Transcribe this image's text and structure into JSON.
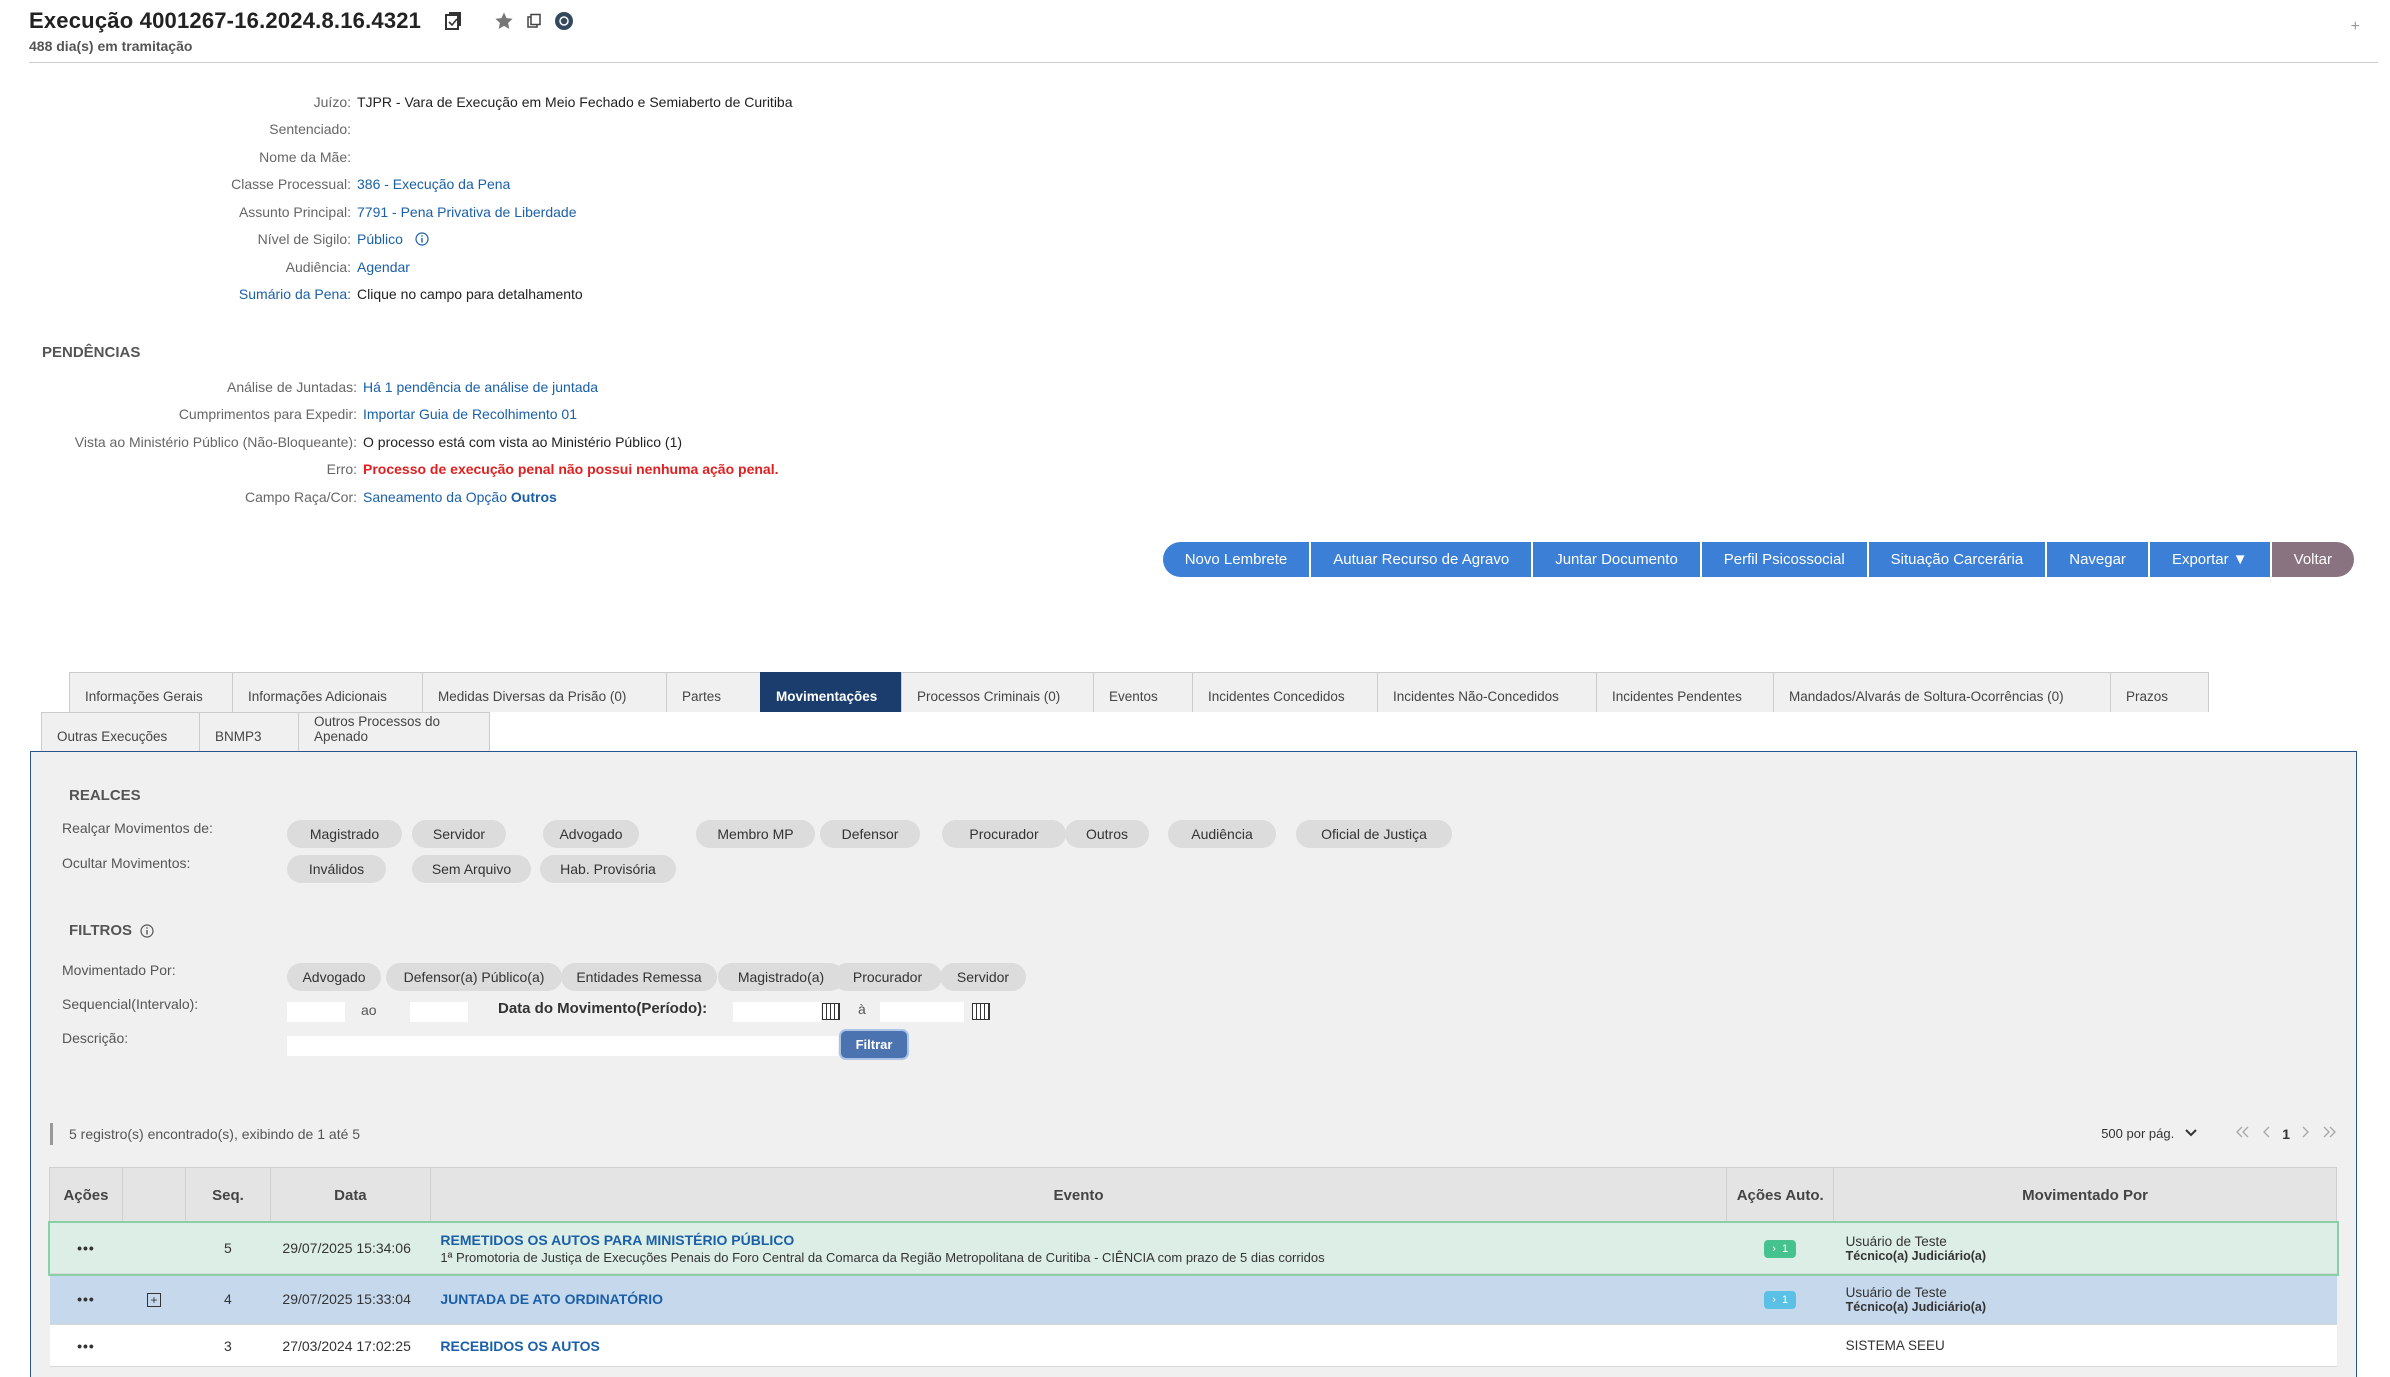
{
  "header": {
    "title": "Execução 4001267-16.2024.8.16.4321",
    "subtitle": "488 dia(s) em tramitação",
    "plus": "+"
  },
  "info": [
    {
      "label": "Juízo:",
      "value": "TJPR - Vara de Execução em Meio Fechado e Semiaberto de Curitiba"
    },
    {
      "label": "Sentenciado:",
      "value": ""
    },
    {
      "label": "Nome da Mãe:",
      "value": ""
    },
    {
      "label": "Classe Processual:",
      "value": "386 - Execução da Pena"
    },
    {
      "label": "Assunto Principal:",
      "value": "7791 - Pena Privativa de Liberdade"
    },
    {
      "label": "Nível de Sigilo:",
      "value": "Público"
    },
    {
      "label": "Audiência:",
      "value": "Agendar"
    },
    {
      "label": "Sumário da Pena:",
      "value": "Clique no campo para detalhamento"
    }
  ],
  "pendencias": {
    "title": "PENDÊNCIAS",
    "rows": [
      {
        "label": "Análise de Juntadas:",
        "value": "Há 1 pendência de análise de juntada"
      },
      {
        "label": "Cumprimentos para Expedir:",
        "value": "Importar Guia de Recolhimento 01"
      },
      {
        "label": "Vista ao Ministério Público (Não-Bloqueante):",
        "value": "O processo está com vista ao Ministério Público (1)"
      },
      {
        "label": "Erro:",
        "value": "Processo de execução penal não possui nenhuma ação penal."
      },
      {
        "label": "Campo Raça/Cor:",
        "value": "Saneamento da Opção ",
        "value_bold": "Outros"
      }
    ]
  },
  "actions": [
    "Novo Lembrete",
    "Autuar Recurso de Agravo",
    "Juntar Documento",
    "Perfil Psicossocial",
    "Situação Carcerária",
    "Navegar",
    "Exportar ▼",
    "Voltar"
  ],
  "tabs_row1": [
    "Informações Gerais",
    "Informações Adicionais",
    "Medidas Diversas da Prisão (0)",
    "Partes",
    "Movimentações",
    "Processos Criminais (0)",
    "Eventos",
    "Incidentes Concedidos",
    "Incidentes Não-Concedidos",
    "Incidentes Pendentes",
    "Mandados/Alvarás de Soltura-Ocorrências (0)",
    "Prazos"
  ],
  "tabs_row2": [
    "Outras Execuções",
    "BNMP3",
    "Outros Processos do Apenado"
  ],
  "active_tab": "Movimentações",
  "realces": {
    "title": "REALCES",
    "realcar_label": "Realçar Movimentos de:",
    "realcar": [
      "Magistrado",
      "Servidor",
      "Advogado",
      "Membro MP",
      "Defensor",
      "Procurador",
      "Outros",
      "Audiência",
      "Oficial de Justiça"
    ],
    "ocultar_label": "Ocultar Movimentos:",
    "ocultar": [
      "Inválidos",
      "Sem Arquivo",
      "Hab. Provisória"
    ]
  },
  "filtros": {
    "title": "FILTROS",
    "movimentado_label": "Movimentado Por:",
    "movimentado": [
      "Advogado",
      "Defensor(a) Público(a)",
      "Entidades Remessa",
      "Magistrado(a)",
      "Procurador",
      "Servidor"
    ],
    "sequencial_label": "Sequencial(Intervalo):",
    "ao": "ao",
    "data_label": "Data do Movimento(Período):",
    "a": "à",
    "descricao_label": "Descrição:",
    "filtrar": "Filtrar"
  },
  "results": {
    "count_text": "5 registro(s) encontrado(s), exibindo de 1 até 5",
    "per_page": "500 por pág.",
    "page": "1"
  },
  "table": {
    "headers": [
      "Ações",
      "",
      "Seq.",
      "Data",
      "Evento",
      "Ações Auto.",
      "Movimentado Por"
    ],
    "rows": [
      {
        "seq": "5",
        "date": "29/07/2025 15:34:06",
        "event": "REMETIDOS OS AUTOS PARA MINISTÉRIO PÚBLICO",
        "event_sub": "1ª Promotoria de Justiça de Execuções Penais do Foro Central da Comarca da Região Metropolitana de Curitiba - CIÊNCIA com prazo de 5 dias corridos",
        "badge": "1",
        "mov_name": "Usuário de Teste",
        "mov_role": "Técnico(a) Judiciário(a)"
      },
      {
        "seq": "4",
        "date": "29/07/2025 15:33:04",
        "event": "JUNTADA DE ATO ORDINATÓRIO",
        "event_sub": "",
        "badge": "1",
        "mov_name": "Usuário de Teste",
        "mov_role": "Técnico(a) Judiciário(a)"
      },
      {
        "seq": "3",
        "date": "27/03/2024 17:02:25",
        "event": "RECEBIDOS OS AUTOS",
        "event_sub": "",
        "badge": "",
        "mov_name": "SISTEMA SEEU",
        "mov_role": ""
      }
    ]
  },
  "colors": {
    "primary": "#3b7fd6",
    "back": "#8a7380",
    "tab_active": "#1a3d6d",
    "error": "#e02020",
    "link": "#1a5fa8"
  }
}
